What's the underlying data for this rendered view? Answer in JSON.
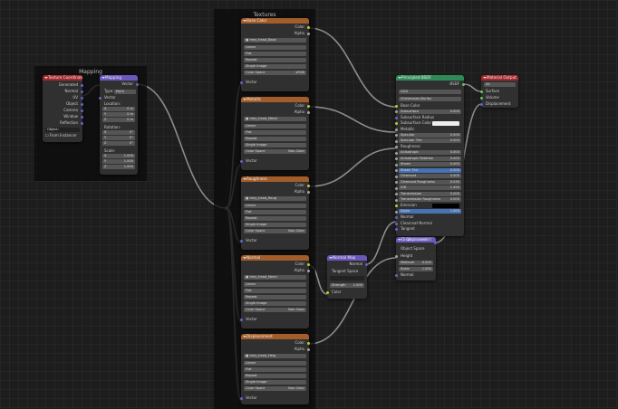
{
  "frames": {
    "mapping": "Mapping",
    "textures": "Textures"
  },
  "texcoord": {
    "title": "Texture Coordinate",
    "outputs": [
      "Generated",
      "Normal",
      "UV",
      "Object",
      "Camera",
      "Window",
      "Reflection"
    ],
    "object_label": "Object:",
    "from_instancer": "From Instancer"
  },
  "mapping": {
    "title": "Mapping",
    "vector_out": "Vector",
    "type_label": "Type:",
    "type_value": "Point",
    "vector_in": "Vector",
    "location": "Location:",
    "loc": [
      [
        "X",
        "0 m"
      ],
      [
        "Y",
        "0 m"
      ],
      [
        "Z",
        "0 m"
      ]
    ],
    "rotation": "Rotation:",
    "rot": [
      [
        "X",
        "0°"
      ],
      [
        "Y",
        "0°"
      ],
      [
        "Z",
        "0°"
      ]
    ],
    "scale": "Scale:",
    "scl": [
      [
        "X",
        "1.000"
      ],
      [
        "Y",
        "1.000"
      ],
      [
        "Z",
        "1.000"
      ]
    ]
  },
  "textures": [
    {
      "title": "Base Color",
      "image": "mey_head_Base",
      "cs_value": "sRGB"
    },
    {
      "title": "Metallic",
      "image": "mey_head_Metal",
      "cs_value": "Non-Color"
    },
    {
      "title": "Roughness",
      "image": "mey_head_Roug",
      "cs_value": "Non-Color"
    },
    {
      "title": "Normal",
      "image": "mey_head_Norm",
      "cs_value": "Non-Color"
    },
    {
      "title": "Displacement",
      "image": "mey_head_Heig",
      "cs_value": "Non-Color"
    }
  ],
  "tex_common": {
    "out_color": "Color",
    "out_alpha": "Alpha",
    "interp": "Linear",
    "proj": "Flat",
    "ext": "Repeat",
    "src": "Single Image",
    "cs_label": "Color Space",
    "vector": "Vector"
  },
  "normalmap": {
    "title": "Normal Map",
    "out": "Normal",
    "space": "Tangent Space",
    "strength_label": "Strength",
    "strength_value": "1.000",
    "color": "Color"
  },
  "bsdf": {
    "title": "Principled BSDF",
    "out": "BSDF",
    "dist": "GGX",
    "sss": "Christensen-Burley",
    "rows": [
      {
        "l": "Base Color",
        "v": ""
      },
      {
        "l": "Subsurface",
        "v": "0.000"
      },
      {
        "l": "Subsurface Radius",
        "v": ""
      },
      {
        "l": "Subsurface Color",
        "v": ""
      },
      {
        "l": "Metallic",
        "v": ""
      },
      {
        "l": "Specular",
        "v": "0.500"
      },
      {
        "l": "Specular Tint",
        "v": "0.000"
      },
      {
        "l": "Roughness",
        "v": ""
      },
      {
        "l": "Anisotropic",
        "v": "0.000"
      },
      {
        "l": "Anisotropic Rotation",
        "v": "0.000"
      },
      {
        "l": "Sheen",
        "v": "0.000"
      },
      {
        "l": "Sheen Tint",
        "v": "0.500"
      },
      {
        "l": "Clearcoat",
        "v": "0.000"
      },
      {
        "l": "Clearcoat Roughness",
        "v": "0.030"
      },
      {
        "l": "IOR",
        "v": "1.450"
      },
      {
        "l": "Transmission",
        "v": "0.000"
      },
      {
        "l": "Transmission Roughness",
        "v": "0.000"
      },
      {
        "l": "Emission",
        "v": ""
      },
      {
        "l": "Alpha",
        "v": "1.000"
      },
      {
        "l": "Normal",
        "v": ""
      },
      {
        "l": "Clearcoat Normal",
        "v": ""
      },
      {
        "l": "Tangent",
        "v": ""
      }
    ]
  },
  "displacement": {
    "title": "Displacement",
    "out": "Displacement",
    "space": "Object Space",
    "height": "Height",
    "midlevel_label": "Midlevel",
    "midlevel_value": "0.000",
    "scale_label": "Scale",
    "scale_value": "1.000",
    "normal": "Normal"
  },
  "output": {
    "title": "Material Output",
    "target": "All",
    "inputs": [
      "Surface",
      "Volume",
      "Displacement"
    ]
  },
  "colors": {
    "input_hdr": "#a3282f",
    "vector_hdr": "#6c57bd",
    "texture_hdr": "#a35d2a",
    "shader_hdr": "#2f8a57",
    "output_hdr": "#a3282f"
  }
}
